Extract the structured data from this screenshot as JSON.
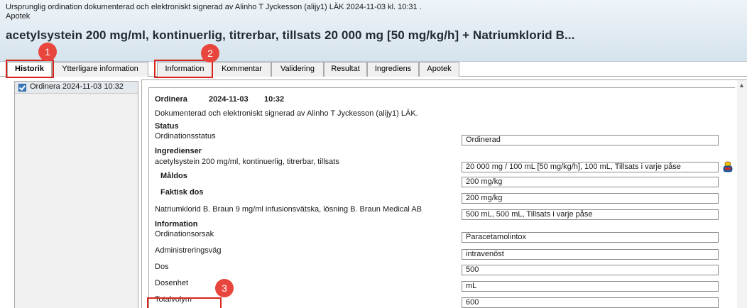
{
  "header": {
    "signature_line": "Ursprunglig ordination dokumenterad och elektroniskt signerad av Alinho T Jyckesson (alijy1) LÄK 2024-11-03 kl. 10:31 .",
    "sub_line": "Apotek",
    "title": "acetylsystein 200 mg/ml, kontinuerlig, titrerbar, tillsats 20 000 mg [50 mg/kg/h] + Natriumklorid B..."
  },
  "tabs": [
    {
      "label": "Historik",
      "active": true
    },
    {
      "label": "Ytterligare information",
      "active": false
    },
    {
      "label": "Information",
      "active": false
    },
    {
      "label": "Kommentar",
      "active": false
    },
    {
      "label": "Validering",
      "active": false
    },
    {
      "label": "Resultat",
      "active": false
    },
    {
      "label": "Ingrediens",
      "active": false
    },
    {
      "label": "Apotek",
      "active": false
    }
  ],
  "history_list": [
    {
      "label": "Ordinera 2024-11-03 10:32",
      "checked": true
    }
  ],
  "detail": {
    "heading": {
      "action": "Ordinera",
      "date": "2024-11-03",
      "time": "10:32"
    },
    "signed_by": "Dokumenterad och elektroniskt signerad av Alinho T Jyckesson (alijy1) LÄK.",
    "status_section": "Status",
    "ordination_status_label": "Ordinationsstatus",
    "ordination_status_value": "Ordinerad",
    "ingredients_section": "Ingredienser",
    "ingredient1_label": "acetylsystein 200 mg/ml, kontinuerlig, titrerbar, tillsats",
    "ingredient1_value": "20 000 mg / 100 mL [50 mg/kg/h], 100 mL, Tillsats i varje påse",
    "target_dose_label": "Måldos",
    "target_dose_value": "200 mg/kg",
    "actual_dose_label": "Faktisk dos",
    "actual_dose_value": "200 mg/kg",
    "ingredient2_label": "Natriumklorid B. Braun 9 mg/ml infusionsvätska, lösning B. Braun Medical AB",
    "ingredient2_value": "500 mL, 500 mL, Tillsats i varje påse",
    "information_section": "Information",
    "reason_label": "Ordinationsorsak",
    "reason_value": "Paracetamolintox",
    "route_label": "Administreringsväg",
    "route_value": "intravenöst",
    "dose_label": "Dos",
    "dose_value": "500",
    "dose_unit_label": "Dosenhet",
    "dose_unit_value": "mL",
    "total_volume_label": "Totalvolym",
    "total_volume_value": "600"
  },
  "markers": [
    "1",
    "2",
    "3"
  ],
  "icons": {
    "medication": "pill-icon",
    "scroll_up": "scroll-up-arrow-icon",
    "checkbox": "checkbox-checked-icon"
  },
  "colors": {
    "marker": "#e8453c",
    "highlight_box": "#d9261c",
    "header_bg": "#dde8f0"
  }
}
